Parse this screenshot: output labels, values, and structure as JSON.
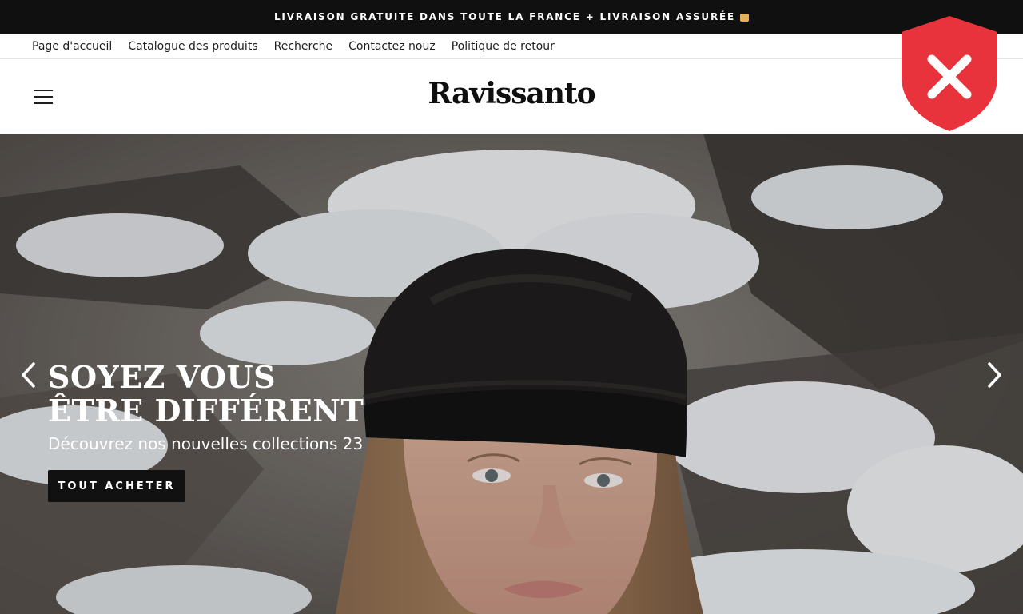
{
  "announcement": {
    "text": "LIVRAISON GRATUITE DANS TOUTE LA FRANCE + LIVRAISON ASSURÉE",
    "emoji_icon": "package-icon"
  },
  "top_nav": {
    "links": [
      "Page d'accueil",
      "Catalogue des produits",
      "Recherche",
      "Contactez nouz",
      "Politique de retour"
    ]
  },
  "header": {
    "logo": "Ravissanto",
    "menu_icon": "hamburger-menu-icon"
  },
  "overlay": {
    "icon": "shield-close-icon",
    "color": "#e8333c"
  },
  "hero": {
    "title_line1": "SOYEZ VOUS",
    "title_line2": "ÊTRE DIFFÉRENT",
    "subtitle": "Découvrez nos nouvelles collections 23",
    "cta": "TOUT ACHETER",
    "prev_icon": "chevron-left-icon",
    "next_icon": "chevron-right-icon"
  }
}
